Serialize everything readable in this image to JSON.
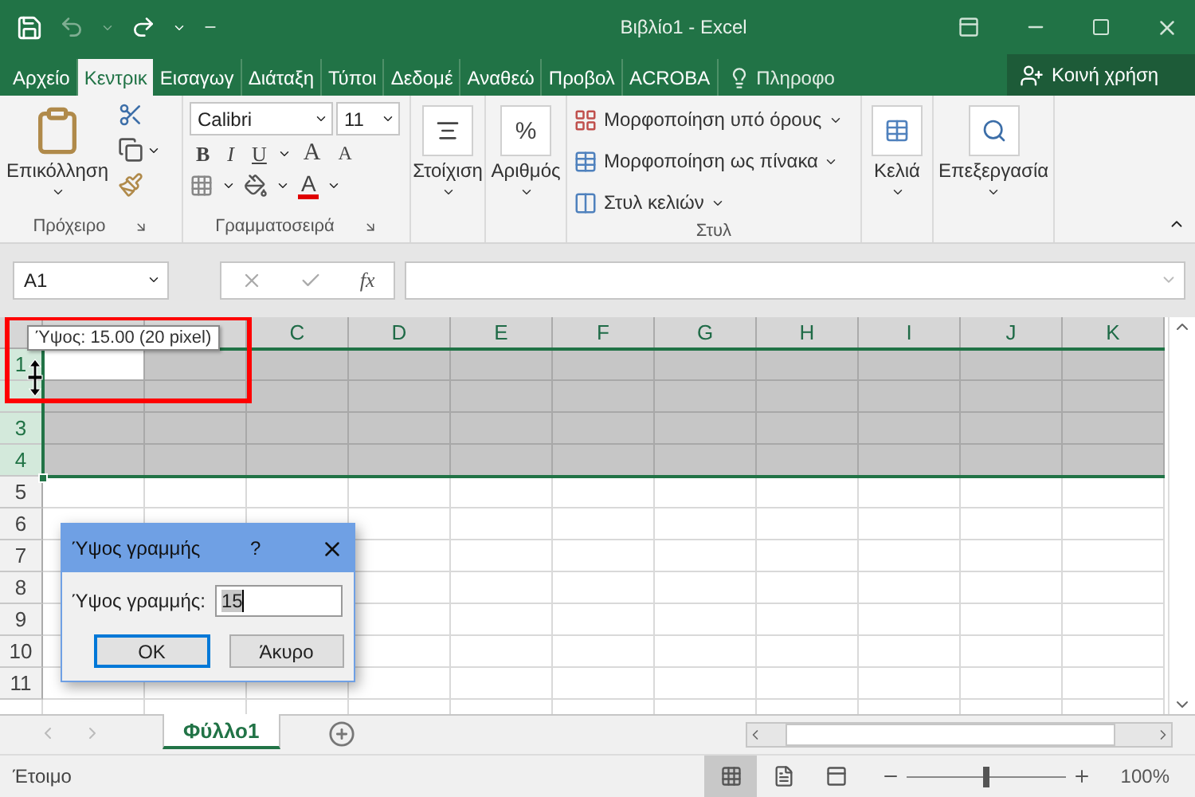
{
  "window": {
    "title": "Βιβλίο1 - Excel"
  },
  "ribbon_tabs": [
    {
      "label": "Αρχείο",
      "selected": false
    },
    {
      "label": "Κεντρικ",
      "selected": true
    },
    {
      "label": "Εισαγωγ",
      "selected": false
    },
    {
      "label": "Διάταξη",
      "selected": false
    },
    {
      "label": "Τύποι",
      "selected": false
    },
    {
      "label": "Δεδομέ",
      "selected": false
    },
    {
      "label": "Αναθεώ",
      "selected": false
    },
    {
      "label": "Προβολ",
      "selected": false
    },
    {
      "label": "ACROBA",
      "selected": false
    }
  ],
  "tell_me": "Πληροφο",
  "share_button": "Κοινή χρήση",
  "clipboard": {
    "paste": "Επικόλληση",
    "group": "Πρόχειρο"
  },
  "font": {
    "name": "Calibri",
    "size": "11",
    "bold": "B",
    "italic": "I",
    "underline": "U",
    "grow": "A",
    "shrink": "A",
    "font_color_letter": "A",
    "group": "Γραμματοσειρά"
  },
  "alignment": {
    "label": "Στοίχιση"
  },
  "number": {
    "symbol": "%",
    "label": "Αριθμός"
  },
  "styles": {
    "items": [
      "Μορφοποίηση υπό όρους",
      "Μορφοποίηση ως πίνακα",
      "Στυλ κελιών"
    ],
    "group": "Στυλ"
  },
  "cells": {
    "label": "Κελιά"
  },
  "editing": {
    "label": "Επεξεργασία"
  },
  "formula_bar": {
    "name_box": "A1",
    "function_label": "fx"
  },
  "sheet": {
    "columns": [
      {
        "kind": "covered"
      },
      {
        "kind": "covered"
      },
      {
        "kind": "letter",
        "label": "C"
      },
      {
        "kind": "letter",
        "label": "D"
      },
      {
        "kind": "letter",
        "label": "E"
      },
      {
        "kind": "letter",
        "label": "F"
      },
      {
        "kind": "letter",
        "label": "G"
      },
      {
        "kind": "letter",
        "label": "H"
      },
      {
        "kind": "letter",
        "label": "I"
      },
      {
        "kind": "letter",
        "label": "J"
      },
      {
        "kind": "letter",
        "label": "K"
      }
    ],
    "rows": [
      {
        "label": "1",
        "selected": true
      },
      {
        "selected": true
      },
      {
        "label": "3",
        "selected": true
      },
      {
        "label": "4",
        "selected": true
      },
      {
        "label": "5",
        "selected": false
      },
      {
        "label": "6",
        "selected": false
      },
      {
        "label": "7",
        "selected": false
      },
      {
        "label": "8",
        "selected": false
      },
      {
        "label": "9",
        "selected": false
      },
      {
        "label": "10",
        "selected": false
      },
      {
        "label": "11",
        "selected": false
      }
    ]
  },
  "tooltip": "Ύψος: 15.00 (20 pixel)",
  "dialog": {
    "title": "Ύψος γραμμής",
    "help": "?",
    "field_label": "Ύψος γραμμής:",
    "value": "15",
    "buttons": [
      {
        "label": "OK",
        "default": true
      },
      {
        "label": "Άκυρο",
        "default": false
      }
    ]
  },
  "sheet_tabs": [
    {
      "label": "Φύλλο1",
      "selected": true
    }
  ],
  "status_bar": {
    "status": "Έτοιμο",
    "views": [
      {
        "kind": "normal",
        "selected": true
      },
      {
        "kind": "page_layout",
        "selected": false
      },
      {
        "kind": "page_break",
        "selected": false
      }
    ],
    "zoom": {
      "level": 0.5,
      "reading": "100%"
    }
  }
}
